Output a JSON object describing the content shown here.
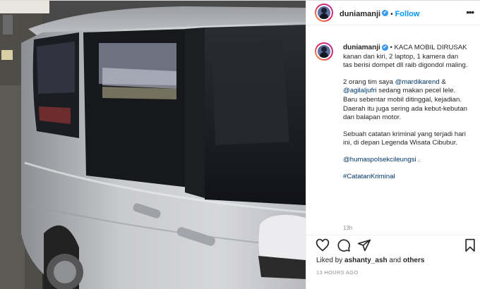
{
  "post": {
    "username": "duniamanji",
    "verified_mark": "✔",
    "follow_label": "Follow",
    "separator": "•",
    "more_label": "•••"
  },
  "caption": {
    "bullet": "•",
    "line1": "KACA MOBIL DIRUSAK kanan dan kiri, 2 laptop, 1 kamera dan tas berisi dompet dll raib digondol maling.",
    "p2_start": "2 orang tim saya",
    "mention1": "@mardikarend",
    "amp": "&",
    "mention2": "@agilaljufri",
    "p2_end": "sedang makan pecel lele. Baru sebentar mobil ditinggal, kejadian.",
    "p3": "Daerah itu juga sering ada kebut-kebutan dan balapan motor.",
    "p4": "Sebuah catatan kriminal yang terjadi hari ini, di depan Legenda Wisata Cibubur.",
    "mention3": "@humaspolsekcileungsi",
    "mention3_suffix": ".",
    "hashtag": "#CatatanKriminal",
    "time_short": "13h"
  },
  "footer": {
    "liked_by_prefix": "Liked by",
    "liked_user": "ashanty_ash",
    "liked_suffix": "and",
    "others": "others",
    "timestamp": "13 HOURS AGO"
  },
  "icons": [
    "heart-icon",
    "comment-icon",
    "share-icon",
    "bookmark-icon",
    "verified-icon",
    "more-icon"
  ],
  "colors": {
    "link": "#00376b",
    "follow": "#0095f6",
    "verified": "#3897f0",
    "muted": "#8e8e8e"
  }
}
